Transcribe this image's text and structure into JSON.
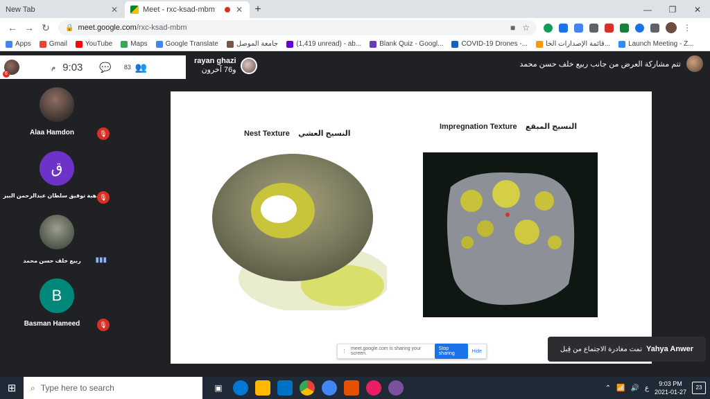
{
  "browser": {
    "tabs": [
      {
        "title": "New Tab",
        "active": false
      },
      {
        "title": "Meet - rxc-ksad-mbm",
        "active": true
      }
    ],
    "url": {
      "host": "meet.google.com",
      "path": "/rxc-ksad-mbm"
    },
    "bookmarks": [
      {
        "label": "Apps",
        "color": "#4285f4"
      },
      {
        "label": "Gmail",
        "color": "#ea4335"
      },
      {
        "label": "YouTube",
        "color": "#ff0000"
      },
      {
        "label": "Maps",
        "color": "#34a853"
      },
      {
        "label": "Google Translate",
        "color": "#4285f4"
      },
      {
        "label": "جامعة الموصل",
        "color": "#795548"
      },
      {
        "label": "(1,419 unread) - ab...",
        "color": "#6001d2"
      },
      {
        "label": "Blank Quiz - Googl...",
        "color": "#673ab7"
      },
      {
        "label": "COVID-19 Drones -...",
        "color": "#1565c0"
      },
      {
        "label": "قائمة الإصدارات الخا...",
        "color": "#ff9800"
      },
      {
        "label": "Launch Meeting - Z...",
        "color": "#2d8cff"
      }
    ]
  },
  "meet": {
    "presenting_text": "تتم مشاركة العرض من جانب ربيع خلف حسن محمد",
    "clock": {
      "time": "9:03",
      "ampm": "م"
    },
    "people_count": "83",
    "my_badge": "6",
    "speaker": {
      "name": "rayan ghazi",
      "others": "و76 آخرون"
    },
    "participants": [
      {
        "name": "Alaa Hamdon",
        "initial": "",
        "color": "#3e2723",
        "muted": true
      },
      {
        "name": "هبة توفيق سلطان عبدالرحمن البيز...",
        "initial": "ق",
        "color": "#6d33c9",
        "muted": true
      },
      {
        "name": "ربيع خلف حسن محمد",
        "initial": "",
        "color": "#4e5a4a",
        "muted": false
      },
      {
        "name": "Basman Hameed",
        "initial": "B",
        "color": "#00897b",
        "muted": true
      }
    ],
    "slide": {
      "left_caption_ar": "النسيج العشي",
      "left_caption_en": "Nest Texture",
      "right_caption_ar": "النسيج المبقع",
      "right_caption_en": "Impregnation Texture"
    },
    "share_bar": {
      "text": "meet.google.com is sharing your screen.",
      "stop": "Stop sharing",
      "hide": "Hide"
    },
    "toast": {
      "name": "Yahya Anwer",
      "text": "تمت مغادرة الاجتماع من قِبل"
    }
  },
  "taskbar": {
    "search_placeholder": "Type here to search",
    "lang": "ع",
    "time": "9:03 PM",
    "date": "2021-01-27",
    "notifications": "23"
  }
}
